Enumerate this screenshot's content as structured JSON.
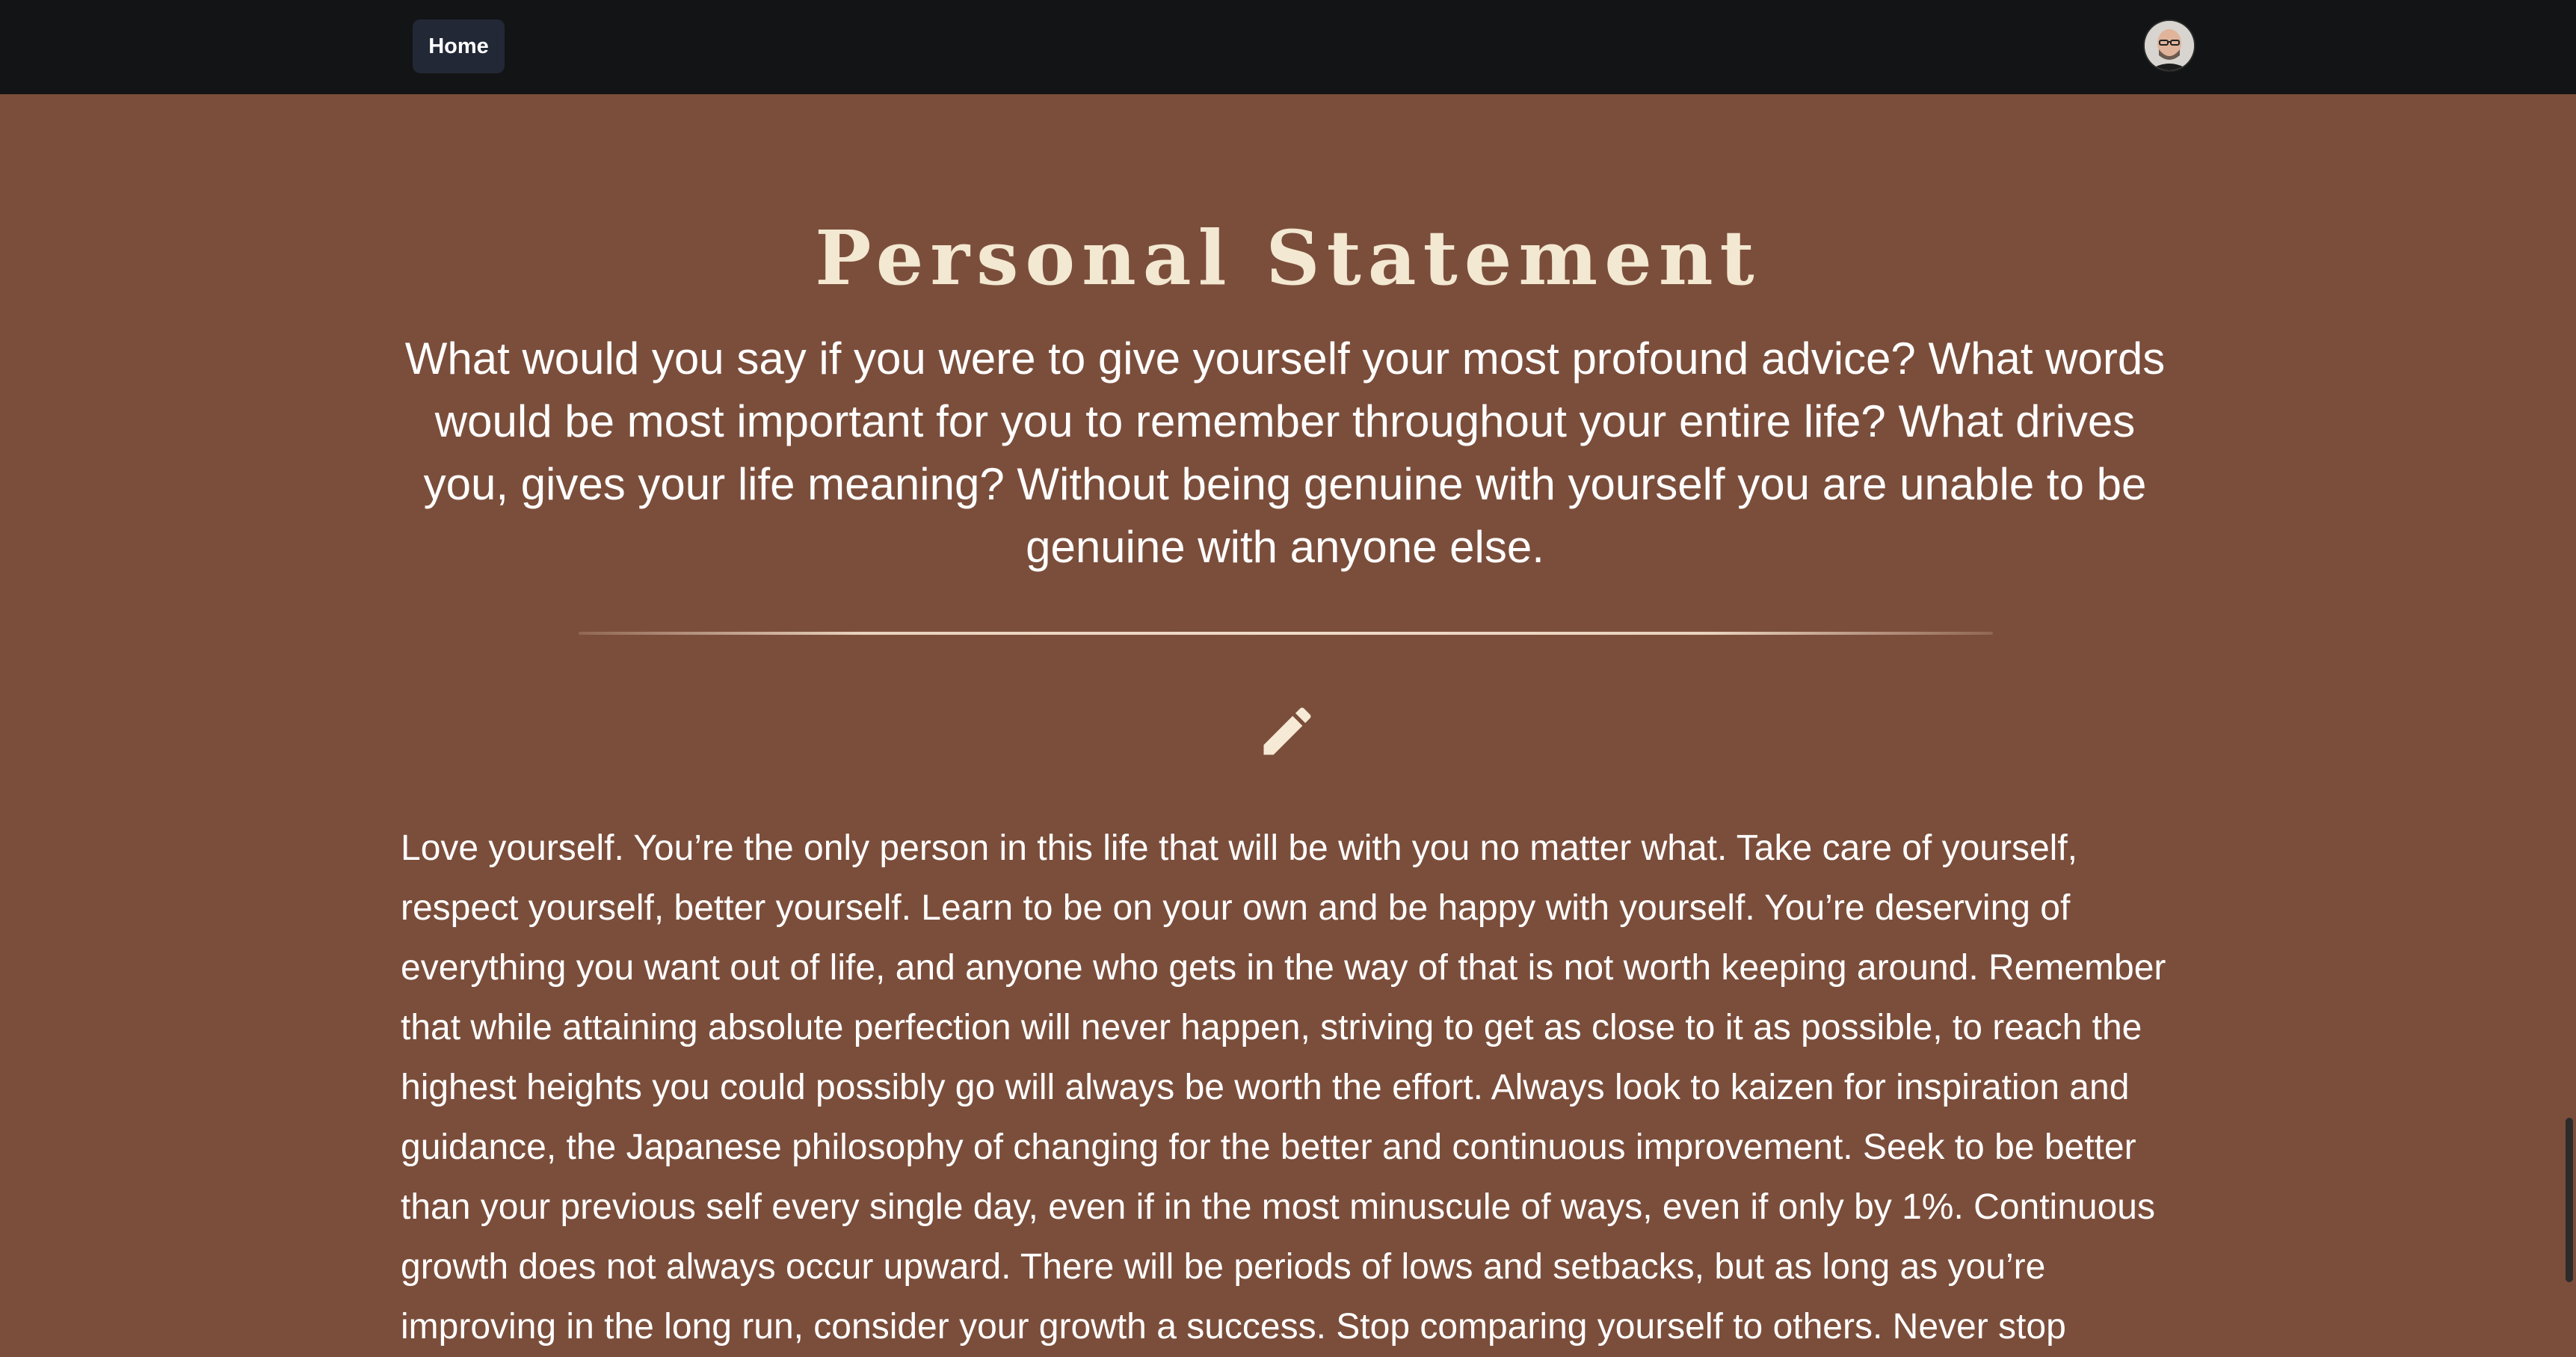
{
  "nav": {
    "home_label": "Home"
  },
  "page": {
    "title": "Personal Statement",
    "intro": "What would you say if you were to give yourself your most profound advice? What words would be most important for you to remember throughout your entire life? What drives you, gives your life meaning? Without being genuine with yourself you are unable to be genuine with anyone else.",
    "statement": "Love yourself. You’re the only person in this life that will be with you no matter what. Take care of yourself, respect yourself, better yourself. Learn to be on your own and be happy with yourself. You’re deserving of everything you want out of life, and anyone who gets in the way of that is not worth keeping around. Remember that while attaining absolute perfection will never happen, striving to get as close to it as possible, to reach the highest heights you could possibly go will always be worth the effort. Always look to kaizen for inspiration and guidance, the Japanese philosophy of changing for the better and continuous improvement. Seek to be better than your previous self every single day, even if in the most minuscule of ways, even if only by 1%. Continuous growth does not always occur upward. There will be periods of lows and setbacks, but as long as you’re improving in the long run, consider your growth a success. Stop comparing yourself to others. Never stop"
  },
  "icons": {
    "edit": "pencil-icon",
    "profile": "avatar"
  },
  "colors": {
    "topbar": "#131416",
    "background": "#7b4e3b",
    "title": "#f3e8d2",
    "text": "#ffffff",
    "home_button": "#232837"
  }
}
